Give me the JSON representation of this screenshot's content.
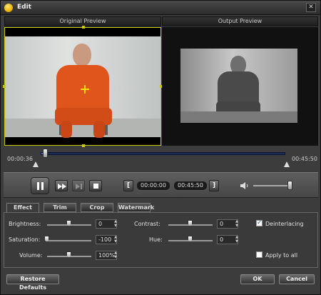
{
  "window": {
    "title": "Edit",
    "close_glyph": "✕"
  },
  "preview": {
    "original_label": "Original Preview",
    "output_label": "Output Preview"
  },
  "timeline": {
    "start_time": "00:00:36",
    "end_time": "00:45:50",
    "progress": 0.02
  },
  "controls": {
    "clip_start": "00:00:00",
    "clip_end": "00:45:50",
    "volume_level": 0.96,
    "icons": [
      "pause-icon",
      "fast-forward-icon",
      "next-frame-icon",
      "stop-icon",
      "mark-in-icon",
      "mark-out-icon",
      "speaker-icon"
    ]
  },
  "tabs": [
    {
      "label": "Effect",
      "active": true
    },
    {
      "label": "Trim",
      "active": false
    },
    {
      "label": "Crop",
      "active": false
    },
    {
      "label": "Watermark",
      "active": false
    }
  ],
  "effect": {
    "brightness": {
      "label": "Brightness:",
      "value": "0",
      "level": 0.5
    },
    "contrast": {
      "label": "Contrast:",
      "value": "0",
      "level": 0.5
    },
    "saturation": {
      "label": "Saturation:",
      "value": "-100",
      "level": 0.0
    },
    "hue": {
      "label": "Hue:",
      "value": "0",
      "level": 0.5
    },
    "volume": {
      "label": "Volume:",
      "value": "100%",
      "level": 0.5
    },
    "deinterlacing": {
      "label": "Deinterlacing",
      "checked": true
    },
    "apply_all": {
      "label": "Apply to all",
      "checked": false
    }
  },
  "buttons": {
    "restore": "Restore Defaults",
    "ok": "OK",
    "cancel": "Cancel"
  },
  "colors": {
    "accent": "#c8c800",
    "track": "#4c6dc0",
    "jumpsuit": "#e0551c"
  }
}
